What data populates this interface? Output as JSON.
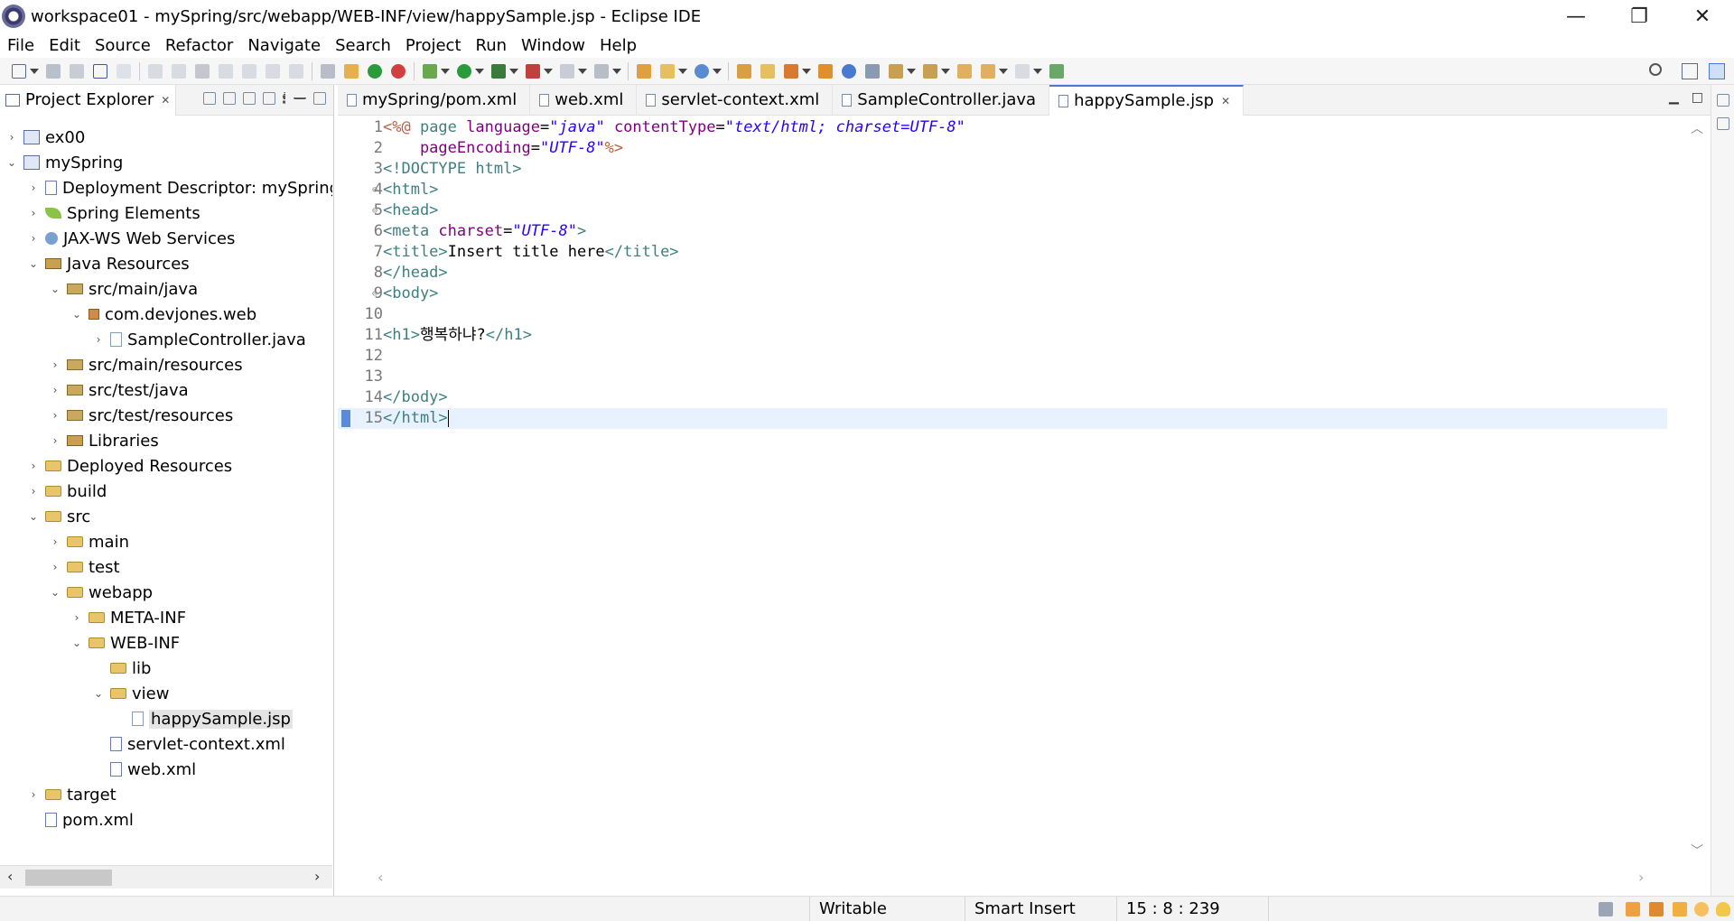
{
  "window": {
    "title": "workspace01 - mySpring/src/webapp/WEB-INF/view/happySample.jsp - Eclipse IDE",
    "minimize": "—",
    "restore": "❐",
    "close": "✕"
  },
  "menu": [
    "File",
    "Edit",
    "Source",
    "Refactor",
    "Navigate",
    "Search",
    "Project",
    "Run",
    "Window",
    "Help"
  ],
  "project_explorer": {
    "title": "Project Explorer",
    "close": "✕",
    "tree": [
      {
        "label": "ex00",
        "twisty": "›",
        "icon": "project"
      },
      {
        "label": "mySpring",
        "twisty": "⌄",
        "icon": "project"
      },
      {
        "label": "Deployment Descriptor: mySpring",
        "twisty": "›",
        "icon": "xml"
      },
      {
        "label": "Spring Elements",
        "twisty": "›",
        "icon": "leaf"
      },
      {
        "label": "JAX-WS Web Services",
        "twisty": "›",
        "icon": "globe"
      },
      {
        "label": "Java Resources",
        "twisty": "⌄",
        "icon": "lib"
      },
      {
        "label": "src/main/java",
        "twisty": "⌄",
        "icon": "srcf"
      },
      {
        "label": "com.devjones.web",
        "twisty": "⌄",
        "icon": "pkg"
      },
      {
        "label": "SampleController.java",
        "twisty": "›",
        "icon": "file"
      },
      {
        "label": "src/main/resources",
        "twisty": "›",
        "icon": "srcf"
      },
      {
        "label": "src/test/java",
        "twisty": "›",
        "icon": "srcf"
      },
      {
        "label": "src/test/resources",
        "twisty": "›",
        "icon": "srcf"
      },
      {
        "label": "Libraries",
        "twisty": "›",
        "icon": "lib"
      },
      {
        "label": "Deployed Resources",
        "twisty": "›",
        "icon": "folder"
      },
      {
        "label": "build",
        "twisty": "›",
        "icon": "folder"
      },
      {
        "label": "src",
        "twisty": "⌄",
        "icon": "folder"
      },
      {
        "label": "main",
        "twisty": "›",
        "icon": "folder"
      },
      {
        "label": "test",
        "twisty": "›",
        "icon": "folder"
      },
      {
        "label": "webapp",
        "twisty": "⌄",
        "icon": "folder"
      },
      {
        "label": "META-INF",
        "twisty": "›",
        "icon": "folder"
      },
      {
        "label": "WEB-INF",
        "twisty": "⌄",
        "icon": "folder"
      },
      {
        "label": "lib",
        "twisty": "",
        "icon": "folder"
      },
      {
        "label": "view",
        "twisty": "⌄",
        "icon": "folder"
      },
      {
        "label": "happySample.jsp",
        "twisty": "",
        "icon": "file"
      },
      {
        "label": "servlet-context.xml",
        "twisty": "",
        "icon": "xml"
      },
      {
        "label": "web.xml",
        "twisty": "",
        "icon": "xml"
      },
      {
        "label": "target",
        "twisty": "›",
        "icon": "folder"
      },
      {
        "label": "pom.xml",
        "twisty": "",
        "icon": "xml"
      }
    ]
  },
  "editor": {
    "tabs": [
      "mySpring/pom.xml",
      "web.xml",
      "servlet-context.xml",
      "SampleController.java",
      "happySample.jsp"
    ],
    "active_tab": "happySample.jsp",
    "tab_close": "✕",
    "line_numbers": [
      "1",
      "2",
      "3",
      "4",
      "5",
      "6",
      "7",
      "8",
      "9",
      "10",
      "11",
      "12",
      "13",
      "14",
      "15"
    ],
    "lines": {
      "l1_a": "<%@",
      "l1_b": " page ",
      "l1_c": "language",
      "l1_d": "=",
      "l1_e": "\"java\"",
      "l1_f": " contentType",
      "l1_g": "=",
      "l1_h": "\"text/html; charset=UTF-8\"",
      "l2_a": "    pageEncoding",
      "l2_b": "=",
      "l2_c": "\"UTF-8\"",
      "l2_d": "%>",
      "l3": "<!DOCTYPE html>",
      "l4": "<html>",
      "l5": "<head>",
      "l6_a": "<meta ",
      "l6_b": "charset",
      "l6_c": "=",
      "l6_d": "\"UTF-8\"",
      "l6_e": ">",
      "l7_a": "<title>",
      "l7_b": "Insert title here",
      "l7_c": "</title>",
      "l8": "</head>",
      "l9": "<body>",
      "l11_a": "<h1>",
      "l11_b": "행복하냐?",
      "l11_c": "</h1>",
      "l14": "</body>",
      "l15": "</html>"
    }
  },
  "status": {
    "writable": "Writable",
    "insert_mode": "Smart Insert",
    "position": "15 : 8 : 239"
  }
}
